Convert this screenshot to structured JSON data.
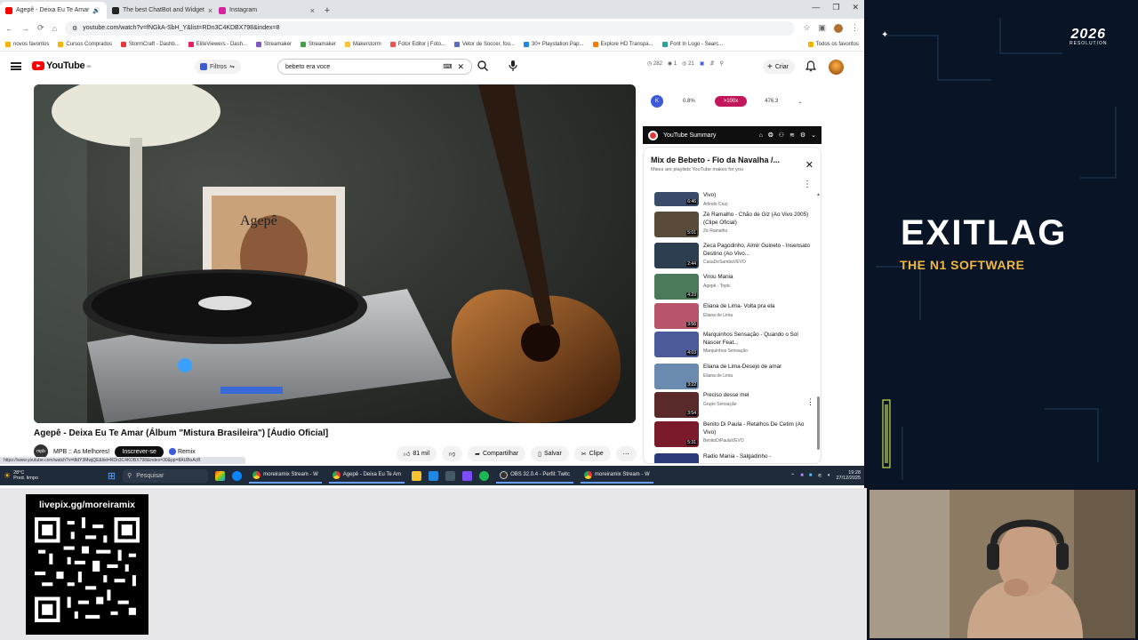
{
  "browser": {
    "tabs": [
      {
        "label": "Agepê - Deixa Eu Te Amar",
        "color": "#ff0000",
        "active": true
      },
      {
        "label": "The best ChatBot and Widget",
        "color": "#222222",
        "active": false
      },
      {
        "label": "Instagram",
        "color": "#d6249f",
        "active": false
      }
    ],
    "url": "youtube.com/watch?v=fNGkA-SbH_Y&list=RDn3C4KDBX798&index=8",
    "bookmarks": [
      "novos favoritos",
      "Cursos Comprados",
      "StormCraft - Dashb...",
      "EliteViewers - Dash...",
      "Streamaker",
      "Streamaker",
      "Makerstorm",
      "Fotor Editor | Foto...",
      "Vetor de Soccer, foo...",
      "30+ Playstation Pap...",
      "Explore HD Transpa...",
      "Font In Logo - Searc..."
    ],
    "bookmarks_all": "Todos os favoritos",
    "status_url": "https://www.youtube.com/watch?v=t8dY3MwjQE&list=RDn3C4KDBX798&index=30&pp=8AUBoAcB"
  },
  "youtube": {
    "logo_text": "YouTube",
    "logo_country": "BR",
    "filtros": "Filtros",
    "search_value": "bebeto era voce",
    "header_stats": [
      "282",
      "1",
      "21"
    ],
    "criar": "Criar",
    "video_title": "Agepê - Deixa Eu Te Amar (Álbum \"Mistura Brasileira\") [Áudio Oficial]",
    "album_label": "Agepê",
    "channel_name": "MPB :: As Melhores!",
    "channel_avatar_text": "mpb",
    "subscribe": "Inscrever-se",
    "remix": "Remix",
    "likes": "81 mil",
    "share": "Compartilhar",
    "save": "Salvar",
    "clip": "Clipe"
  },
  "extension": {
    "badge": "K",
    "values": [
      "0.8%",
      ">100x",
      "476.3"
    ],
    "summary_label": "YouTube Summary"
  },
  "playlist": {
    "title": "Mix de Bebeto - Fio da Navalha /...",
    "subtitle": "Mixes are playlists YouTube makes for you",
    "items": [
      {
        "title": "Vivo)",
        "channel": "Arlindo Cruz",
        "duration": "6:46",
        "color": "#3a4a6a"
      },
      {
        "title": "Zé Ramalho - Chão de Giz (Ao Vivo 2005) (Clipe Oficial)",
        "channel": "Zé Ramalho",
        "duration": "5:01",
        "color": "#5a4a3a"
      },
      {
        "title": "Zeca Pagodinho, Almir Guineto - Insensato Destino (Ao Vivo...",
        "channel": "CasaDeSambaVEVO",
        "duration": "2:44",
        "color": "#2c3e50"
      },
      {
        "title": "Virou Mania",
        "channel": "Agepê - Topic",
        "duration": "4:23",
        "color": "#4a7a5a"
      },
      {
        "title": "Eliana de Lima- Volta pra ela",
        "channel": "Eliana de Lima",
        "duration": "3:56",
        "color": "#b8556a"
      },
      {
        "title": "Marquinhos Sensação - Quando o Sol Nascer Feat...",
        "channel": "Marquinhos Sensação",
        "duration": "4:03",
        "color": "#4a5a9a"
      },
      {
        "title": "Eliana de Lima-Desejo de amar",
        "channel": "Eliana de Lima",
        "duration": "3:22",
        "color": "#6a8ab0"
      },
      {
        "title": "Preciso desse mel",
        "channel": "Grupo Sensação",
        "duration": "3:54",
        "color": "#5a2a2a"
      },
      {
        "title": "Benito Di Paula - Retalhos De Cetim (Ao Vivo)",
        "channel": "BenitoDiPaulaVEVO",
        "duration": "5:31",
        "color": "#7a1a2a"
      },
      {
        "title": "Radio Mania - Salgadinho -",
        "channel": "",
        "duration": "",
        "color": "#2a3a7a"
      }
    ]
  },
  "taskbar": {
    "weather_temp": "28°C",
    "weather_desc": "Pred. limpo",
    "search": "Pesquisar",
    "apps": [
      "moreiramix Stream - W",
      "Agepê - Deixa Eu Te Am",
      "OBS 32.0.4 - Perfil: Twitc",
      "moreiramix Stream - W"
    ],
    "time": "19:28",
    "date": "27/12/2025"
  },
  "overlay": {
    "brand_top": "2026",
    "brand_top_sub": "RESOLUTION",
    "exitlag": "EXITLAG",
    "exitlag_tagline": "THE N1 SOFTWARE",
    "livepix": "livepix.gg/moreiramix"
  }
}
